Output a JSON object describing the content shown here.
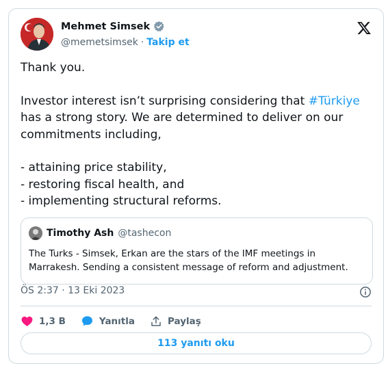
{
  "author": {
    "display_name": "Mehmet Simsek",
    "handle": "@memetsimsek",
    "separator": "·",
    "follow_label": "Takip et"
  },
  "tweet": {
    "line1": "Thank you.",
    "para2_before": "Investor interest isn’t surprising considering that ",
    "hashtag": "#Türkiye",
    "para2_after": "\nhas a strong story. We are determined to deliver on our\ncommitments including,",
    "list": [
      "- attaining price stability,",
      "- restoring fiscal health, and",
      "- implementing structural reforms."
    ]
  },
  "quote": {
    "name": "Timothy Ash",
    "handle": "@tashecon",
    "text": "The Turks - Simsek, Erkan are the stars of the IMF meetings in Marrakesh. Sending a consistent message of reform and adjustment."
  },
  "meta": {
    "timestamp": "ÖS 2:37 · 13 Eki 2023"
  },
  "actions": {
    "likes": "1,3 B",
    "reply_label": "Yanıtla",
    "share_label": "Paylaş"
  },
  "replies_button": "113 yanıtı oku",
  "colors": {
    "accent": "#1d9bf0",
    "like": "#f91880",
    "text": "#0f1419",
    "muted": "#536471",
    "border": "#cfd9de"
  },
  "icons": [
    "x-logo-icon",
    "verified-badge-icon",
    "info-icon",
    "heart-icon",
    "reply-bubble-icon",
    "share-icon"
  ]
}
